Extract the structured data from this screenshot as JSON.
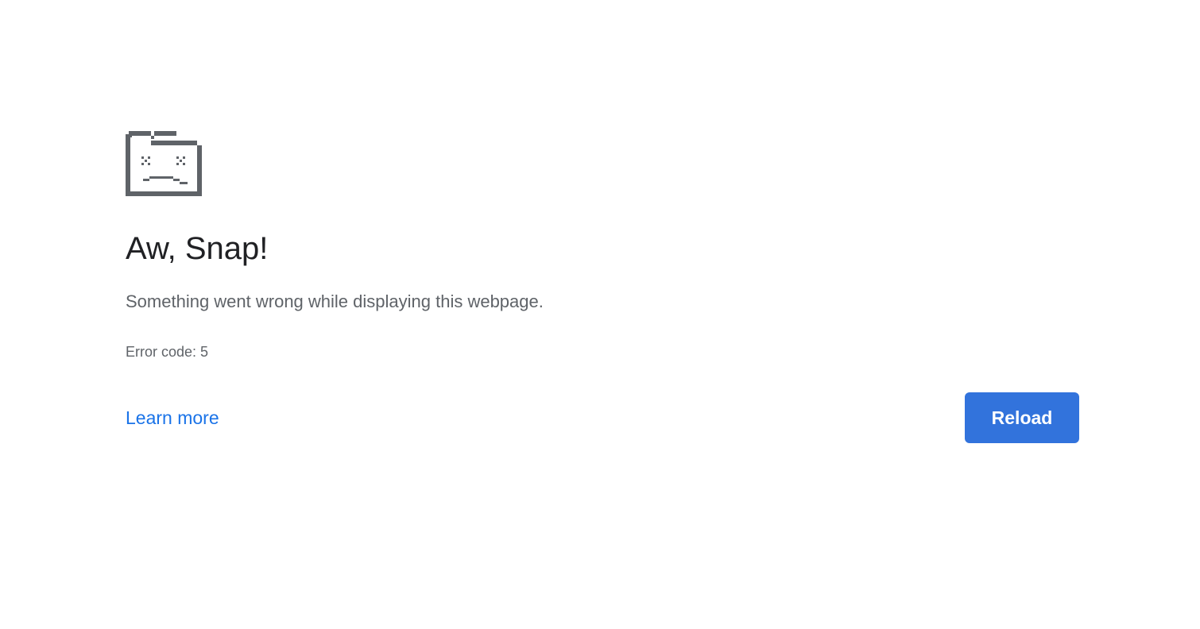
{
  "icon": {
    "name": "sad-tab-icon",
    "color": "#5f6368"
  },
  "title": "Aw, Snap!",
  "message": "Something went wrong while displaying this webpage.",
  "error_code": "Error code: 5",
  "actions": {
    "learn_more_label": "Learn more",
    "reload_label": "Reload"
  },
  "colors": {
    "link": "#1a73e8",
    "button": "#3273dc",
    "title": "#202124",
    "text": "#5f6368"
  }
}
